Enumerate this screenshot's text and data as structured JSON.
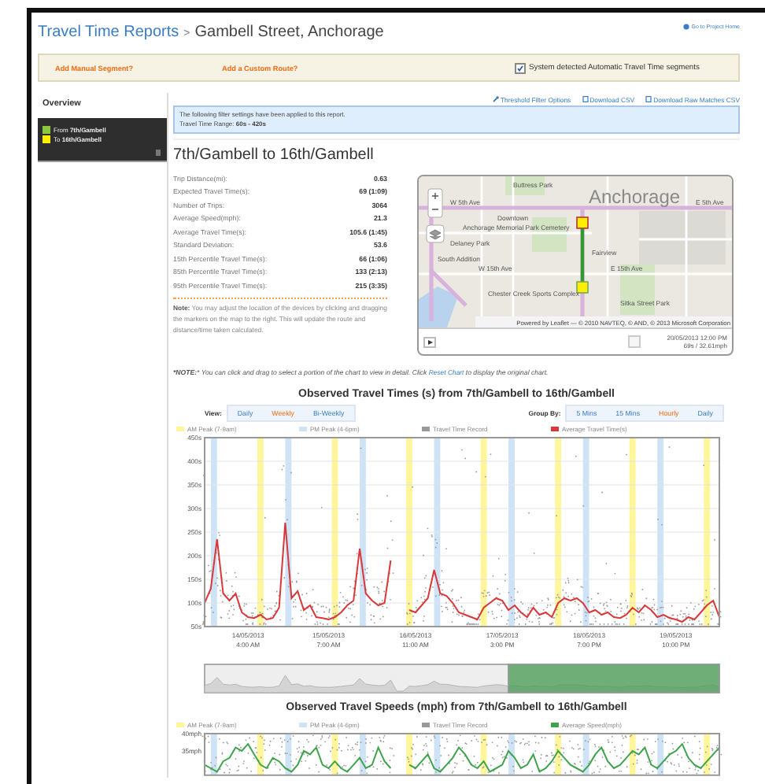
{
  "header": {
    "breadcrumb_link": "Travel Time Reports",
    "separator": ">",
    "page_title": "Gambell Street, Anchorage",
    "project_link": "Go to Project Home"
  },
  "toolbar": {
    "add_segment": "Add Manual Segment?",
    "add_route": "Add a Custom Route?",
    "auto_segments": {
      "label": "System detected Automatic Travel Time segments",
      "checked": true
    }
  },
  "sidebar": {
    "title": "Overview",
    "endpoints": [
      {
        "text": "From **7th/Gambell**",
        "color": "#8dc63f"
      },
      {
        "text": "To **16th/Gambell**",
        "color": "#ffee00"
      }
    ]
  },
  "links": [
    "Threshold Filter Options",
    "Download CSV",
    "Download Raw Matches CSV"
  ],
  "filter_notice": {
    "text": "The following filter settings have been applied to this report.",
    "range": "Travel Time Range: **60s - 420s**"
  },
  "segment_title": "7th/Gambell to 16th/Gambell",
  "stats": [
    {
      "label": "Trip Distance(mi):",
      "value": "0.63"
    },
    {
      "label": "Expected Travel Time(s):",
      "value": "69 (1:09)"
    },
    {
      "label": "Number of Trips:",
      "value": "3064"
    },
    {
      "label": "Average Speed(mph):",
      "value": "21.3"
    },
    {
      "label": "Average Travel Time(s):",
      "value": "105.6 (1:45)"
    },
    {
      "label": "Standard Deviation:",
      "value": "53.6"
    },
    {
      "label": "15th Percentile Travel Time(s):",
      "value": "66 (1:06)"
    },
    {
      "label": "85th Percentile Travel Time(s):",
      "value": "133 (2:13)"
    },
    {
      "label": "95th Percentile Travel Time(s):",
      "value": "215 (3:35)"
    }
  ],
  "note": "**Note:** You may adjust the location of the devices by clicking and dragging the markers on the map to the right. This will update the route and distance/time taken calculated.",
  "map": {
    "labels": [
      "Anchorage",
      "Buttress Park",
      "W 5th Ave",
      "E 5th Ave",
      "Downtown",
      "Delaney Park",
      "South Addition",
      "Anchorage Memorial Park Cemetery",
      "Fairview",
      "W 15th Ave",
      "E 15th Ave",
      "Chester Creek Sports Complex",
      "Sitka Street Park"
    ],
    "attribution": "Powered by Leaflet — © 2010 NAVTEQ, © AND, © 2013 Microsoft Corporation",
    "timestamp": "20/05/2013 12:00 PM",
    "reading": "69s / 32.61mph"
  },
  "chart_note": {
    "text": "***NOTE:*** *You can click and drag to select a portion of the chart to view in detail. Click*",
    "link": "Reset Chart",
    "after": "to display the original chart."
  },
  "travel_time_chart": {
    "view_label": "View:",
    "views": [
      {
        "label": "Daily",
        "selected": false
      },
      {
        "label": "Weekly",
        "selected": true
      },
      {
        "label": "Bi-Weekly",
        "selected": false
      }
    ],
    "group_label": "Group By:",
    "groups": [
      {
        "label": "5 Mins",
        "selected": false
      },
      {
        "label": "15 Mins",
        "selected": false
      },
      {
        "label": "Hourly",
        "selected": true
      },
      {
        "label": "Daily",
        "selected": false
      }
    ],
    "legend": [
      {
        "label": "AM Peak (7-9am)",
        "color": "#fff59a"
      },
      {
        "label": "PM Peak (4-6pm)",
        "color": "#cfe3f7"
      },
      {
        "label": "Travel Time Record",
        "color": "#999999"
      }
    ],
    "chart_data": {
      "type": "line",
      "title": "Observed Travel Times (s) from 7th/Gambell to 16th/Gambell",
      "ylim": [
        50,
        450
      ],
      "grid": true,
      "categories": [
        null,
        null,
        null,
        null,
        null,
        null,
        null,
        "14/05/2013 4:00 AM",
        null,
        null,
        null,
        null,
        null,
        null,
        null,
        null,
        null,
        null,
        null,
        null,
        "15/05/2013 7:00 AM",
        null,
        null,
        null,
        null,
        null,
        null,
        null,
        null,
        null,
        null,
        null,
        null,
        null,
        "16/05/2013 11:00 AM",
        null,
        null,
        null,
        null,
        null,
        null,
        null,
        null,
        null,
        null,
        null,
        null,
        null,
        "17/05/2013 3:00 PM",
        null,
        null,
        null,
        null,
        null,
        null,
        null,
        null,
        null,
        null,
        null,
        null,
        null,
        "18/05/2013 7:00 PM",
        null,
        null,
        null,
        null,
        null,
        null,
        null,
        null,
        null,
        null,
        null,
        null,
        null,
        "19/05/2013 10:00 PM",
        null,
        null,
        null,
        null,
        null,
        null,
        null
      ],
      "yticks": [
        {
          "value": 50,
          "label": "50s"
        },
        {
          "value": 100,
          "label": "100s"
        },
        {
          "value": 150,
          "label": "150s"
        },
        {
          "value": 200,
          "label": "200s"
        },
        {
          "value": 250,
          "label": "250s"
        },
        {
          "value": 300,
          "label": "300s"
        },
        {
          "value": 350,
          "label": "350s"
        },
        {
          "value": 400,
          "label": "400s"
        },
        {
          "value": 450,
          "label": "450s"
        }
      ],
      "series": [
        {
          "name": "Average Travel Time(s)",
          "color": "#d9383a",
          "values": [
            100,
            130,
            235,
            120,
            105,
            120,
            80,
            70,
            68,
            75,
            65,
            68,
            90,
            270,
            110,
            125,
            85,
            95,
            70,
            68,
            65,
            70,
            80,
            95,
            105,
            215,
            120,
            105,
            95,
            100,
            190,
            null,
            null,
            85,
            80,
            95,
            110,
            170,
            120,
            115,
            100,
            80,
            75,
            70,
            65,
            90,
            100,
            110,
            105,
            85,
            95,
            80,
            70,
            90,
            75,
            80,
            70,
            100,
            110,
            105,
            110,
            100,
            80,
            85,
            75,
            80,
            70,
            68,
            75,
            90,
            80,
            95,
            85,
            70,
            75,
            68,
            65,
            60,
            70,
            65,
            80,
            95,
            105,
            70
          ]
        }
      ]
    }
  },
  "speed_chart": {
    "legend": [
      {
        "label": "AM Peak (7-9am)",
        "color": "#fff59a"
      },
      {
        "label": "PM Peak (4-6pm)",
        "color": "#cfe3f7"
      },
      {
        "label": "Travel Time Record",
        "color": "#999999"
      }
    ],
    "chart_data": {
      "type": "line",
      "title": "Observed Travel Speeds (mph) from 7th/Gambell to 16th/Gambell",
      "ylim": [
        28,
        40
      ],
      "yticks": [
        {
          "value": 40,
          "label": "40mph"
        },
        {
          "value": 35,
          "label": "35mph"
        }
      ],
      "categories": [
        null,
        null,
        null,
        null,
        null,
        null,
        null,
        null,
        null,
        null,
        null,
        null,
        null,
        null,
        null,
        null,
        null,
        null,
        null,
        null,
        null,
        null,
        null,
        null,
        null,
        null,
        null,
        null,
        null,
        null,
        null,
        null,
        null,
        null,
        null,
        null,
        null,
        null,
        null,
        null,
        null,
        null,
        null,
        null,
        null,
        null,
        null,
        null,
        null,
        null,
        null,
        null,
        null,
        null,
        null,
        null,
        null,
        null,
        null,
        null,
        null,
        null,
        null,
        null,
        null,
        null,
        null,
        null,
        null,
        null,
        null,
        null,
        null,
        null,
        null,
        null,
        null,
        null,
        null,
        null,
        null,
        null,
        null,
        null
      ],
      "series": [
        {
          "name": "Average Speed(mph)",
          "color": "#3fa34d",
          "values": [
            31,
            30,
            29,
            32,
            33,
            36,
            35,
            37,
            34,
            31,
            30,
            33,
            32,
            30,
            29,
            31,
            35,
            34,
            36,
            31,
            30,
            32,
            30,
            29,
            31,
            33,
            30,
            31,
            36,
            32,
            30,
            null,
            null,
            31,
            30,
            32,
            34,
            30,
            29,
            31,
            33,
            36,
            34,
            31,
            30,
            32,
            29,
            30,
            31,
            35,
            33,
            30,
            31,
            34,
            29,
            30,
            32,
            35,
            33,
            31,
            30,
            29,
            31,
            34,
            36,
            32,
            30,
            31,
            33,
            35,
            34,
            36,
            31,
            30,
            32,
            34,
            35,
            37,
            33,
            31,
            30,
            32,
            34,
            36
          ]
        }
      ]
    }
  }
}
